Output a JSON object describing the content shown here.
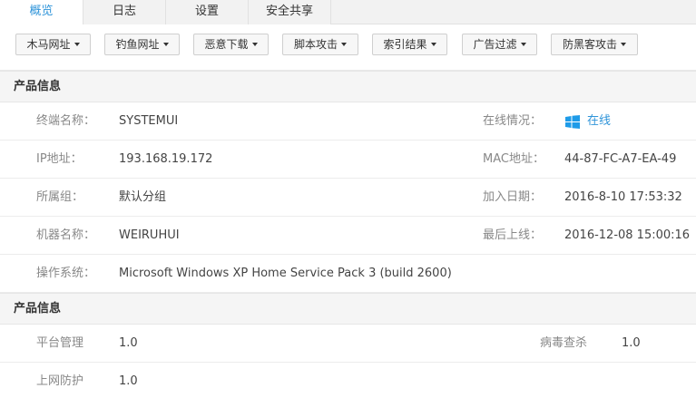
{
  "tabs": [
    {
      "label": "概览",
      "active": true
    },
    {
      "label": "日志",
      "active": false
    },
    {
      "label": "设置",
      "active": false
    },
    {
      "label": "安全共享",
      "active": false
    }
  ],
  "filters": [
    "木马网址",
    "钓鱼网址",
    "恶意下载",
    "脚本攻击",
    "索引结果",
    "广告过滤",
    "防黑客攻击"
  ],
  "product_section": {
    "title": "产品信息",
    "terminal_name_label": "终端名称：",
    "terminal_name": "SYSTEMUI",
    "online_status_label": "在线情况：",
    "online_status": "在线",
    "ip_label": "IP地址：",
    "ip": "193.168.19.172",
    "mac_label": "MAC地址：",
    "mac": "44-87-FC-A7-EA-49",
    "group_label": "所属组：",
    "group": "默认分组",
    "join_date_label": "加入日期：",
    "join_date": "2016-8-10 17:53:32",
    "machine_name_label": "机器名称：",
    "machine_name": "WEIRUHUI",
    "last_online_label": "最后上线：",
    "last_online": "2016-12-08 15:00:16",
    "os_label": "操作系统：",
    "os": "Microsoft Windows XP Home Service Pack 3 (build 2600)"
  },
  "module_section": {
    "title": "产品信息",
    "platform_label": "平台管理",
    "platform_version": "1.0",
    "antivirus_label": "病毒查杀",
    "antivirus_version": "1.0",
    "web_protect_label": "上网防护",
    "web_protect_version": "1.0"
  },
  "colors": {
    "accent": "#2f94d9",
    "windows_icon": "#1e9be8"
  },
  "icons": {
    "online": "windows-logo-icon",
    "dropdown": "caret-down-icon"
  }
}
